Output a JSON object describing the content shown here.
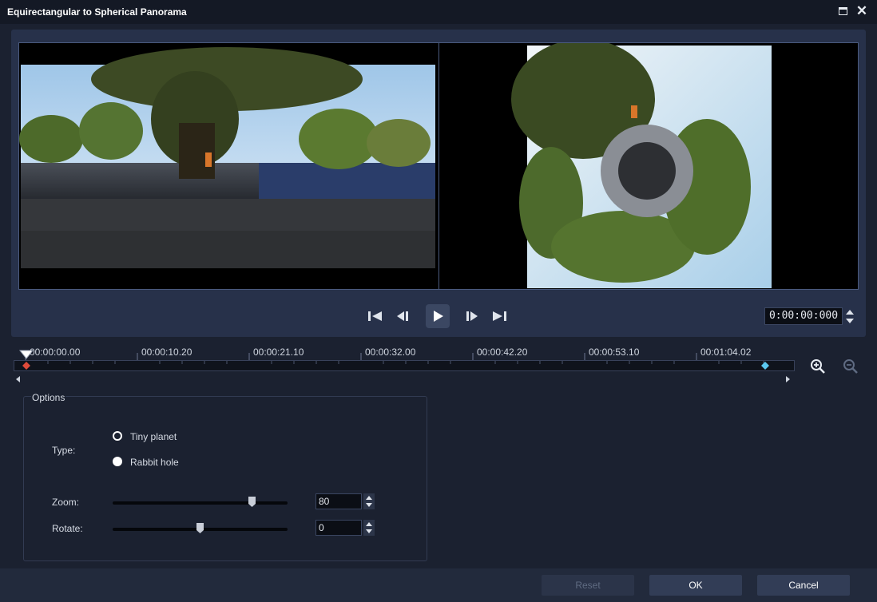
{
  "window": {
    "title": "Equirectangular to Spherical Panorama",
    "maximize_icon": "maximize-icon",
    "close_icon": "close-icon"
  },
  "preview": {
    "source_label": "",
    "result_label": ""
  },
  "playback": {
    "buttons": [
      "skip-to-start-icon",
      "previous-frame-icon",
      "play-icon",
      "next-frame-icon",
      "skip-to-end-icon"
    ],
    "timecode": "0:00:00:000"
  },
  "timeline": {
    "ticks": [
      "00:00:00.00",
      "00:00:10.20",
      "00:00:21.10",
      "00:00:32.00",
      "00:00:42.20",
      "00:00:53.10",
      "00:01:04.02"
    ],
    "zoom_in_icon": "zoom-in-icon",
    "zoom_out_icon": "zoom-out-icon"
  },
  "options": {
    "legend": "Options",
    "type_label": "Type:",
    "type_options": [
      {
        "label": "Tiny planet",
        "selected": true
      },
      {
        "label": "Rabbit hole",
        "selected": false
      }
    ],
    "zoom_label": "Zoom:",
    "zoom_value": "80",
    "rotate_label": "Rotate:",
    "rotate_value": "0"
  },
  "footer": {
    "reset_label": "Reset",
    "ok_label": "OK",
    "cancel_label": "Cancel"
  },
  "colors": {
    "background": "#1b2130",
    "panel": "#27314a",
    "accent_blue": "#5bc8f0",
    "accent_red": "#e04a3a"
  }
}
